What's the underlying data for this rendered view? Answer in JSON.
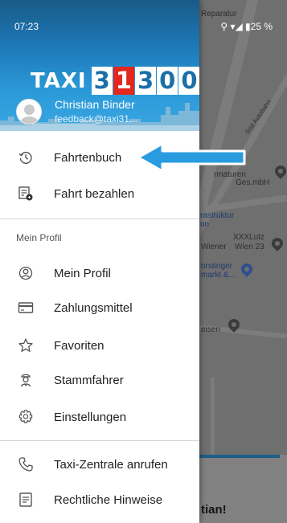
{
  "status": {
    "time": "07:23",
    "icons": "⚲ ▾◢ ▮25 %"
  },
  "header": {
    "brand_taxi": "TAXI",
    "brand_d1": "3",
    "brand_d2": "1",
    "brand_d3": "3",
    "brand_d4": "0",
    "brand_d5": "0",
    "user_name": "Christian Binder",
    "user_email": "feedback@taxi31..."
  },
  "menu": {
    "trip_log": "Fahrtenbuch",
    "pay_trip": "Fahrt bezahlen",
    "section_profile": "Mein Profil",
    "my_profile": "Mein Profil",
    "payment_methods": "Zahlungsmittel",
    "favorites": "Favoriten",
    "regular_driver": "Stammfahrer",
    "settings": "Einstellungen",
    "call_center": "Taxi-Zentrale anrufen",
    "legal": "Rechtliche Hinweise"
  },
  "map": {
    "label_reparatur": "Reparatur",
    "label_autobahn": "Süd Autobahn",
    "label_armaturen_1": "rmaturen",
    "label_armaturen_2": "Ges.mbH",
    "label_infra_1": "rastruktur",
    "label_infra_2": "on",
    "label_xxxlutz_1": "XXXLutz",
    "label_xxxlutz_2": "Wien 23",
    "label_vosendorf": "orstinger",
    "label_vosendorf_2": "markt &...",
    "label_eisen": "eisen",
    "label_wiener": "Wiener",
    "greeting": "tian!"
  },
  "colors": {
    "header_dark": "#195a87",
    "header_light": "#3aa7e2",
    "brand_red": "#e2281f",
    "arrow_blue": "#2b9be0"
  }
}
